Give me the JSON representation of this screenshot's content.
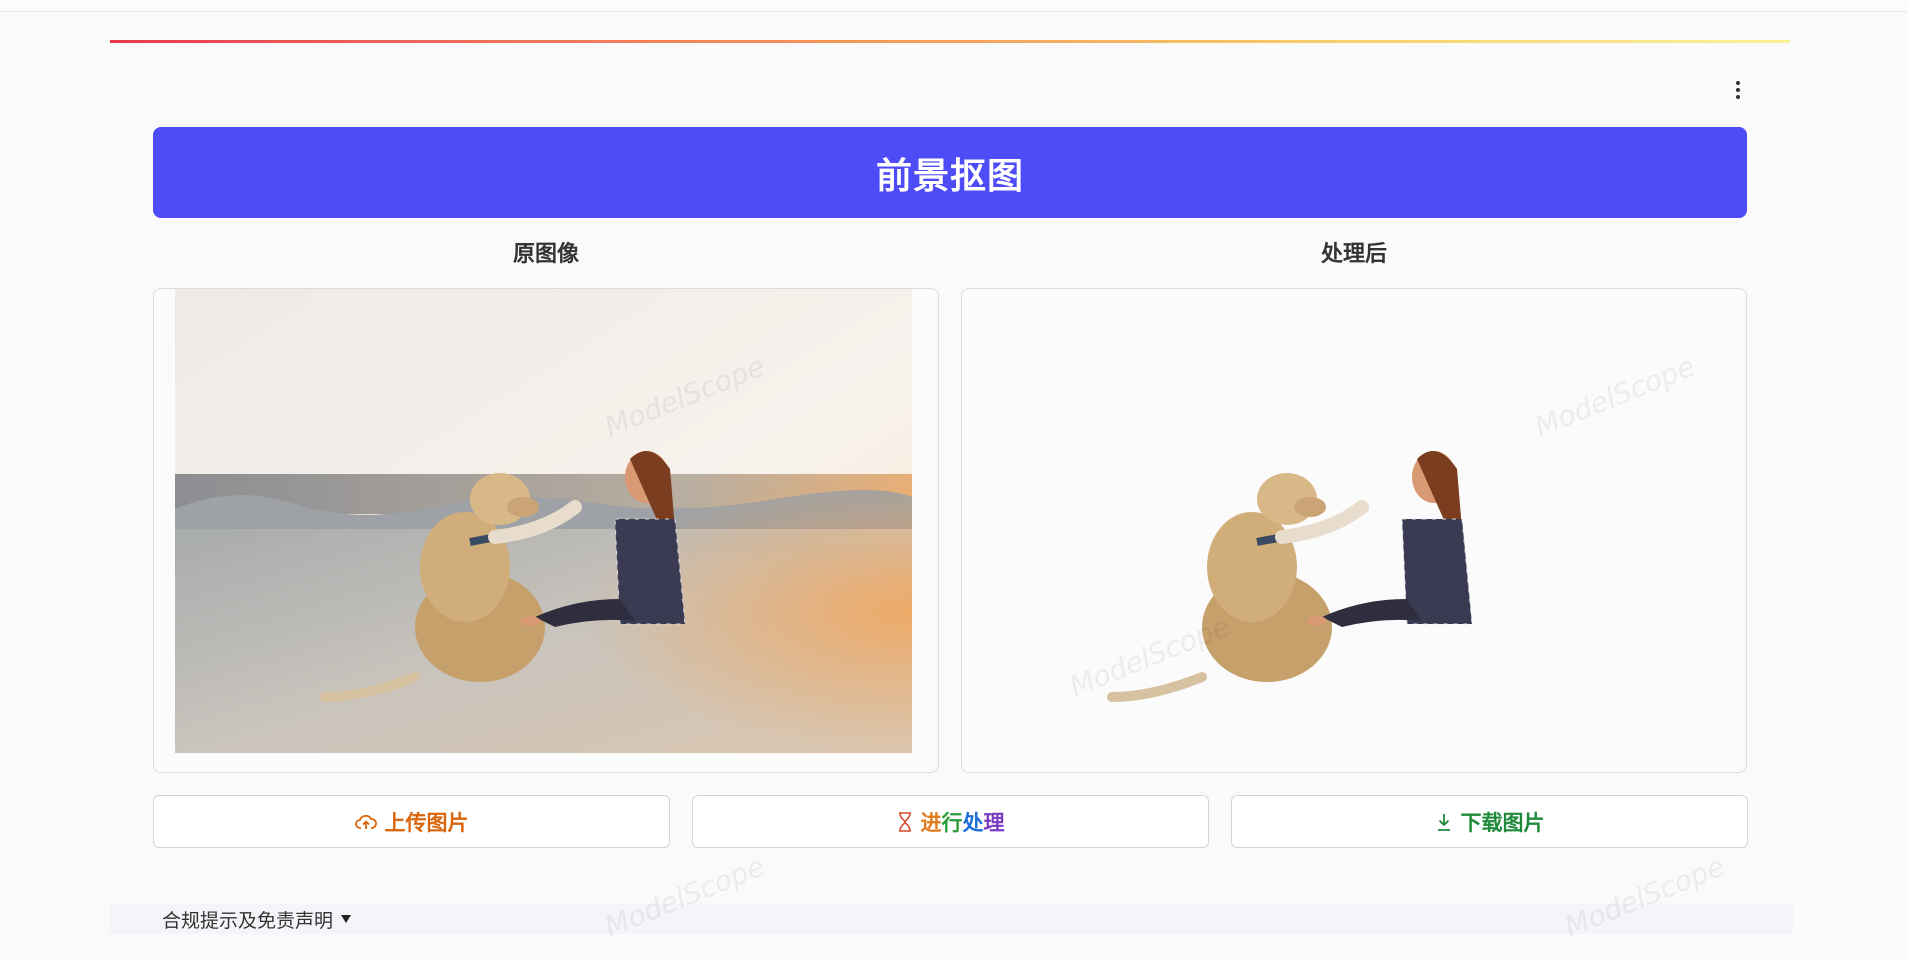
{
  "header": {
    "banner_title": "前景抠图"
  },
  "columns": {
    "original_title": "原图像",
    "processed_title": "处理后"
  },
  "buttons": {
    "upload_label": "上传图片",
    "process_label_parts": [
      "进",
      "行",
      "处",
      "理"
    ],
    "download_label": "下载图片"
  },
  "footer": {
    "disclaimer_label": "合规提示及免责声明"
  },
  "watermark": {
    "text": "ModelScope"
  },
  "icons": {
    "upload": "cloud-upload-icon",
    "process": "hourglass-icon",
    "download": "download-icon",
    "menu": "kebab-menu-icon",
    "disclaimer": "caret-down-icon"
  },
  "colors": {
    "banner": "#4d4cf6",
    "upload": "#d9650c",
    "download": "#1e8a3a",
    "process_gradient": [
      "#e07b1a",
      "#2a9d3a",
      "#1d6fd8",
      "#7b3bbf"
    ]
  }
}
